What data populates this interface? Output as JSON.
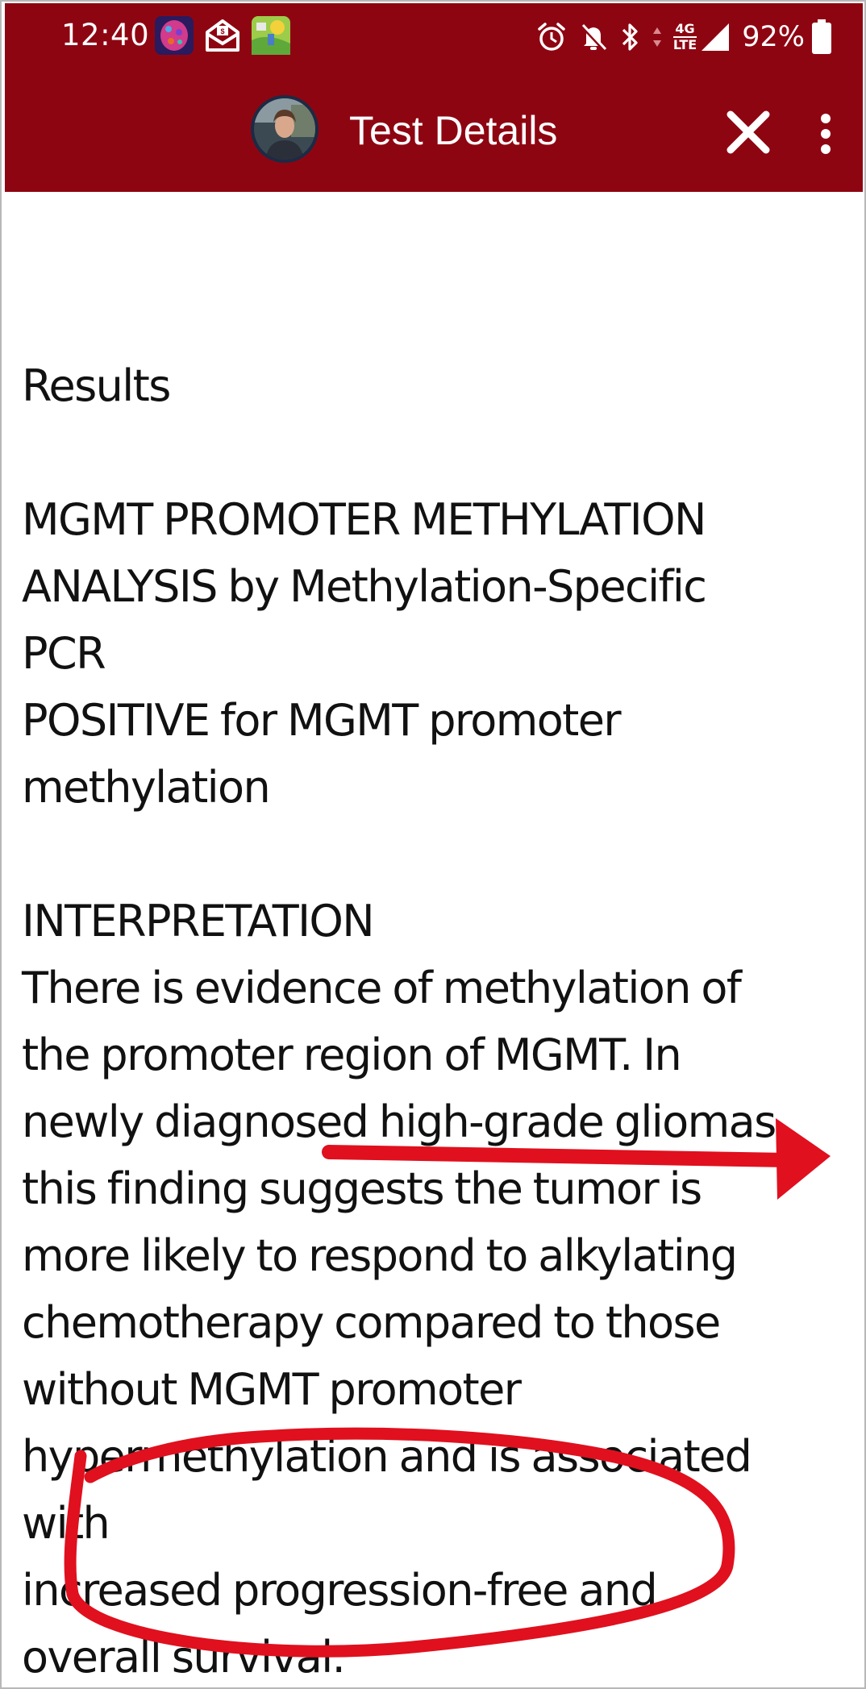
{
  "status_bar": {
    "time": "12:40",
    "app_icons": [
      "brain-app-icon",
      "mail-app-icon",
      "maps-app-icon"
    ],
    "system_icons": [
      "alarm-icon",
      "notifications-off-icon",
      "bluetooth-icon",
      "data-arrows-icon",
      "signal-icon",
      "battery-icon"
    ],
    "network_top": "4G",
    "network_bottom": "LTE",
    "battery": "92%"
  },
  "header": {
    "title": "Test Details",
    "avatar_icon": "profile-avatar",
    "close_icon": "close-icon",
    "menu_icon": "more-vert-icon"
  },
  "report": {
    "heading": "Results",
    "test_name_lines": [
      "MGMT PROMOTER METHYLATION",
      "ANALYSIS by Methylation-Specific",
      "PCR"
    ],
    "result_lines": [
      "POSITIVE for MGMT promoter",
      "methylation"
    ],
    "interpretation_heading": "INTERPRETATION",
    "interpretation_lines": [
      "There is evidence of methylation of",
      "the promoter region of MGMT. In",
      "newly diagnosed high-grade gliomas,",
      "this finding suggests the tumor is",
      "more likely to respond to alkylating",
      "chemotherapy compared to those",
      "without MGMT promoter",
      "hypermethylation and is associated",
      "with",
      "increased progression-free and",
      "overall survival."
    ]
  },
  "colors": {
    "header_background": "#8e0512",
    "annotation_red": "#e0101e",
    "text": "#111111",
    "background": "#ffffff"
  }
}
